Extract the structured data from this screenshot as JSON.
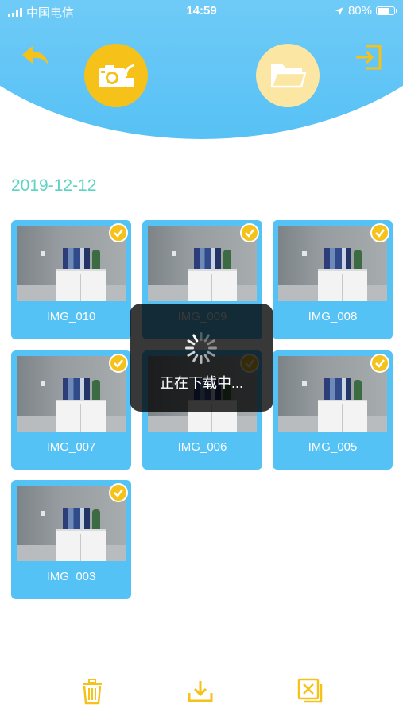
{
  "status_bar": {
    "carrier": "中国电信",
    "time": "14:59",
    "battery": "80%",
    "battery_level": 0.8
  },
  "header": {
    "back_icon": "back-arrow-icon",
    "camera_icon": "camera-wifi-icon",
    "folder_icon": "folder-icon",
    "exit_icon": "exit-icon",
    "accent": "#f6c21a",
    "header_color": "#7dd0f8"
  },
  "date_label": "2019-12-12",
  "photos": [
    {
      "label": "IMG_010",
      "checked": true
    },
    {
      "label": "IMG_009",
      "checked": true
    },
    {
      "label": "IMG_008",
      "checked": true
    },
    {
      "label": "IMG_007",
      "checked": true
    },
    {
      "label": "IMG_006",
      "checked": true
    },
    {
      "label": "IMG_005",
      "checked": true
    },
    {
      "label": "IMG_003",
      "checked": true
    }
  ],
  "toast": {
    "text": "正在下载中..."
  },
  "bottom_bar": {
    "delete_icon": "trash-icon",
    "download_icon": "download-icon",
    "cancel_icon": "cancel-selection-icon"
  }
}
